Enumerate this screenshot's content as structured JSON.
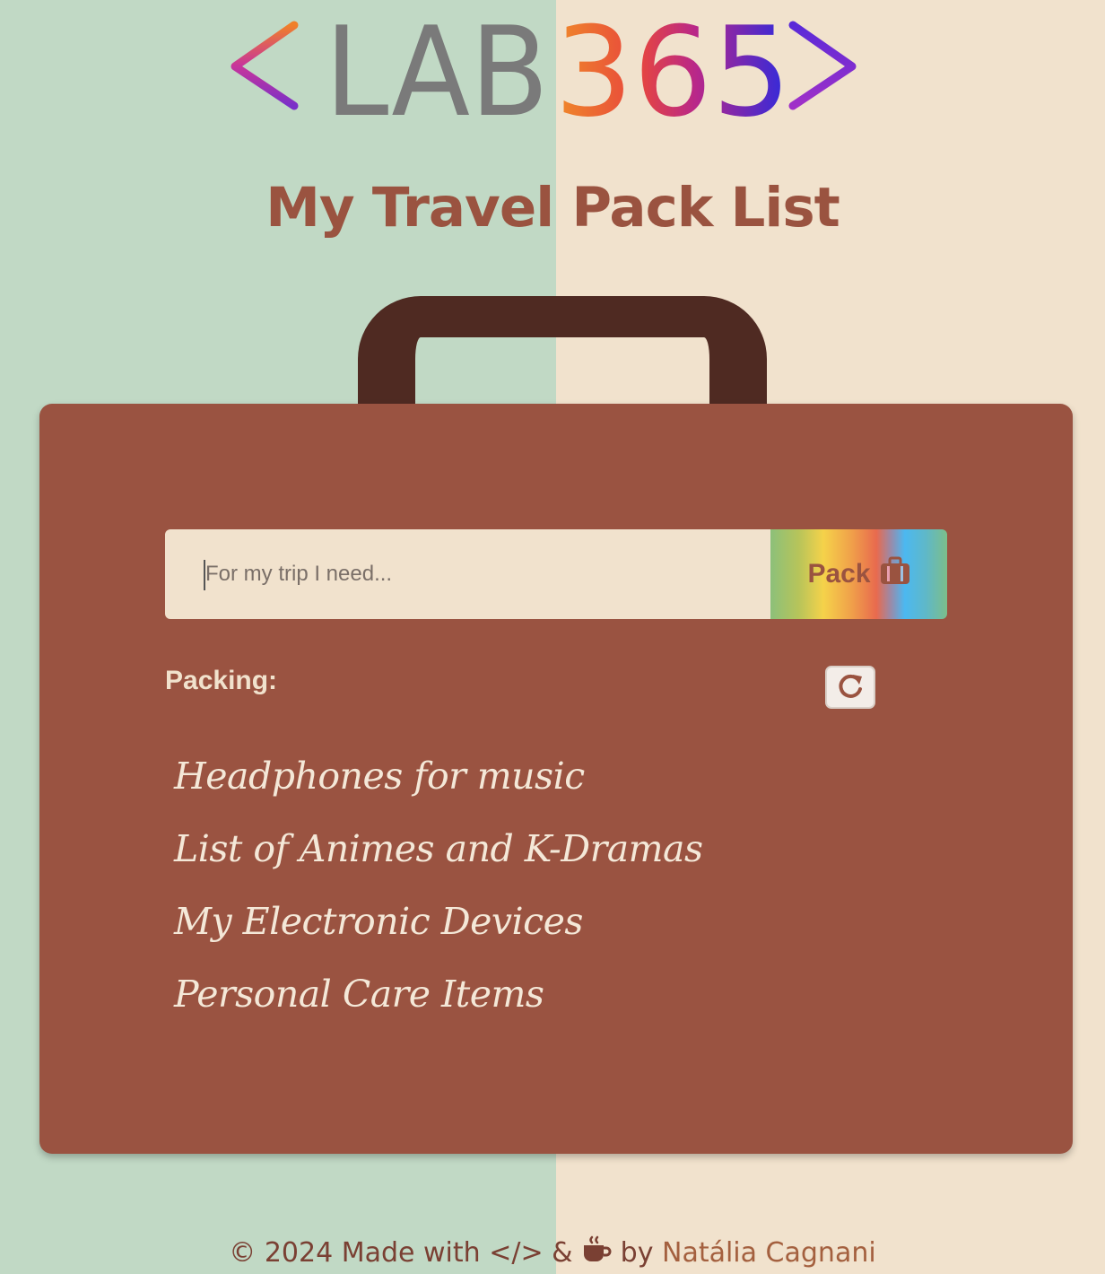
{
  "logo": {
    "part1": "LAB",
    "part2": "365",
    "alt": "LAB365"
  },
  "title": "My Travel Pack List",
  "form": {
    "placeholder": "For my trip I need...",
    "pack_label": "Pack"
  },
  "packing": {
    "label": "Packing:",
    "items": [
      "Headphones for music",
      "List of Animes and K-Dramas",
      "My Electronic Devices",
      "Personal Care Items"
    ]
  },
  "footer": {
    "copyright": "© 2024 Made with",
    "code_symbol": "</>",
    "amp": "&",
    "by": "by",
    "author": "Natália Cagnani"
  },
  "icons": {
    "pack": "suitcase-icon",
    "reset": "rotate-icon",
    "coffee": "coffee-icon"
  },
  "colors": {
    "bg_left": "#c1d9c5",
    "bg_right": "#f1e2cd",
    "suitcase": "#9a5341",
    "handle": "#4f2a22",
    "title": "#9a5340"
  }
}
